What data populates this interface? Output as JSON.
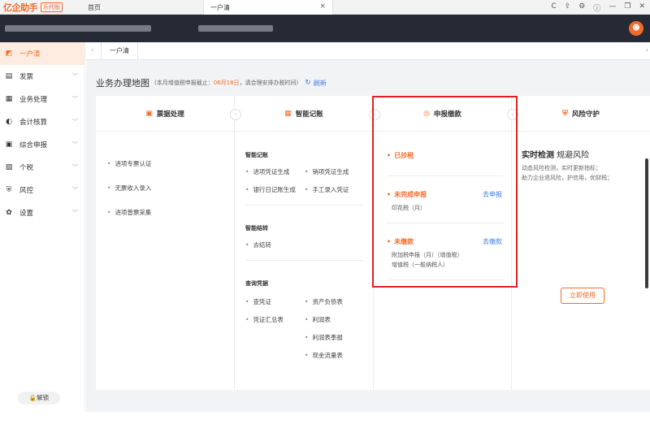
{
  "browser": {
    "logo": "亿企助手",
    "edition": "乐代账",
    "tabs": [
      {
        "label": "首页"
      },
      {
        "label": "一户清",
        "close": "×"
      }
    ],
    "controls": [
      "C",
      "⇪",
      "⚙",
      "ⓘ",
      "—",
      "❐",
      "✕"
    ]
  },
  "header": {
    "avatar": "☻"
  },
  "sidebar": {
    "items": [
      {
        "label": "一户清",
        "icon": "chart-icon",
        "glyph": "◩",
        "active": true
      },
      {
        "label": "发票",
        "icon": "invoice-icon",
        "glyph": "▤"
      },
      {
        "label": "业务处理",
        "icon": "document-icon",
        "glyph": "▦"
      },
      {
        "label": "会计核算",
        "icon": "calculator-icon",
        "glyph": "◐"
      },
      {
        "label": "综合申报",
        "icon": "report-icon",
        "glyph": "▣"
      },
      {
        "label": "个税",
        "icon": "tax-icon",
        "glyph": "▧"
      },
      {
        "label": "风控",
        "icon": "shield-icon",
        "glyph": "⛨"
      },
      {
        "label": "设置",
        "icon": "gear-icon",
        "glyph": "✿"
      }
    ],
    "unlock": "🔒解锁"
  },
  "main": {
    "subtab": "一户清",
    "title": "业务办理地图",
    "deadline_prefix": "(本月增值税申报截止：",
    "deadline_date": "06月18日",
    "deadline_suffix": "，请合理安排办税时间)",
    "refresh": "刷新"
  },
  "columns": {
    "invoice": {
      "title": "票据处理",
      "items": [
        "进项专票认证",
        "无票收入录入",
        "进项普票采集"
      ]
    },
    "bookkeeping": {
      "title": "智能记账",
      "section1": {
        "title": "智能记账",
        "items": [
          "进项凭证生成",
          "销项凭证生成",
          "银行日记账生成",
          "手工录入凭证"
        ]
      },
      "section2": {
        "title": "智能结转",
        "items": [
          "去结转"
        ]
      },
      "section3": {
        "title": "查询凭据",
        "left": [
          "查凭证",
          "凭证汇总表"
        ],
        "right": [
          "资产负债表",
          "利润表",
          "利润表季报",
          "现金流量表"
        ]
      }
    },
    "filing": {
      "title": "申报缴款",
      "status1": "已抄税",
      "status2": "未完成申报",
      "status2_link": "去申报",
      "status2_sub": "印花税（月）",
      "status3": "未缴款",
      "status3_link": "去缴款",
      "status3_sub1": "附加税申报（月）（增值税）",
      "status3_sub2": "增值税（一般纳税人）"
    },
    "risk": {
      "title": "风险守护",
      "headline_bold": "实时检测",
      "headline_rest": " 规避风险",
      "desc1": "动态风险检测，实时更新指标；",
      "desc2": "助力企业退风险，护信用，优财税；",
      "button": "立即使用"
    }
  },
  "colors": {
    "accent": "#f26b2a",
    "link": "#3b7be0",
    "highlight": "#e02020"
  }
}
